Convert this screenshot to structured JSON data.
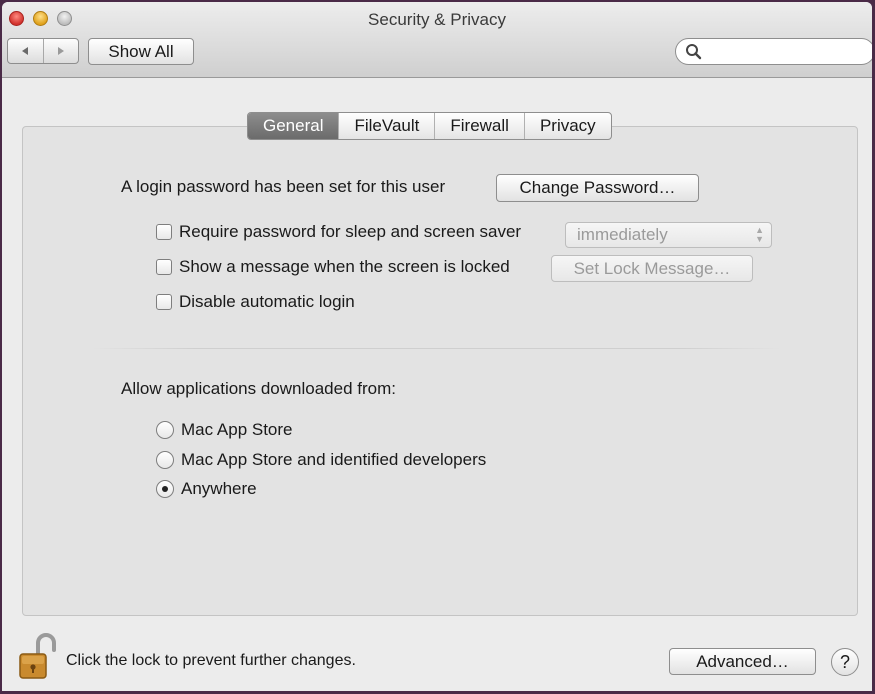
{
  "window": {
    "title": "Security & Privacy"
  },
  "toolbar": {
    "back_icon": "chevron-left-icon",
    "forward_icon": "chevron-right-icon",
    "show_all_label": "Show All",
    "search_placeholder": ""
  },
  "tabs": [
    {
      "label": "General",
      "selected": true
    },
    {
      "label": "FileVault",
      "selected": false
    },
    {
      "label": "Firewall",
      "selected": false
    },
    {
      "label": "Privacy",
      "selected": false
    }
  ],
  "general": {
    "login_text": "A login password has been set for this user",
    "change_password_label": "Change Password…",
    "require_password": {
      "label": "Require password for sleep and screen saver",
      "checked": false
    },
    "require_password_delay": "immediately",
    "show_message": {
      "label": "Show a message when the screen is locked",
      "checked": false
    },
    "set_lock_message_label": "Set Lock Message…",
    "disable_auto_login": {
      "label": "Disable automatic login",
      "checked": false
    },
    "allow_apps_heading": "Allow applications downloaded from:",
    "allow_options": [
      {
        "label": "Mac App Store",
        "selected": false
      },
      {
        "label": "Mac App Store and identified developers",
        "selected": false
      },
      {
        "label": "Anywhere",
        "selected": true
      }
    ]
  },
  "footer": {
    "lock_icon": "unlocked-padlock-icon",
    "lock_text": "Click the lock to prevent further changes.",
    "advanced_label": "Advanced…",
    "help_label": "?"
  },
  "colors": {
    "window_background": "#ececec",
    "selected_tab": "#7a7a7a",
    "outer_background": "#4a2a47"
  }
}
